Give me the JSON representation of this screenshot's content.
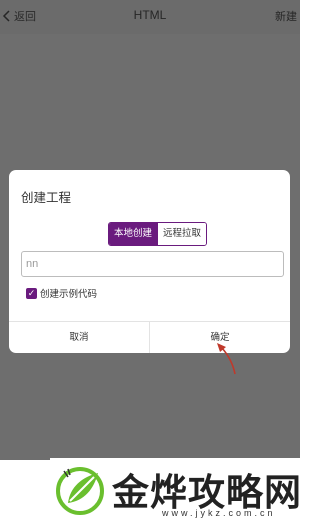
{
  "header": {
    "back_label": "返回",
    "title": "HTML",
    "new_label": "新建"
  },
  "dialog": {
    "title": "创建工程",
    "segments": [
      "本地创建",
      "远程拉取"
    ],
    "selected_segment": "本地创建",
    "name_input": {
      "value": "nn"
    },
    "checkbox": {
      "label": "创建示例代码",
      "checked": true
    },
    "cancel_label": "取消",
    "ok_label": "确定"
  },
  "watermark": {
    "title": "金烨攻略网",
    "url": "www.jykz.com.cn"
  },
  "colors": {
    "accent": "#6a1b7e",
    "overlay": "#6e6e6e",
    "arrow": "#c0392b",
    "logo_green": "#6abf2e"
  }
}
